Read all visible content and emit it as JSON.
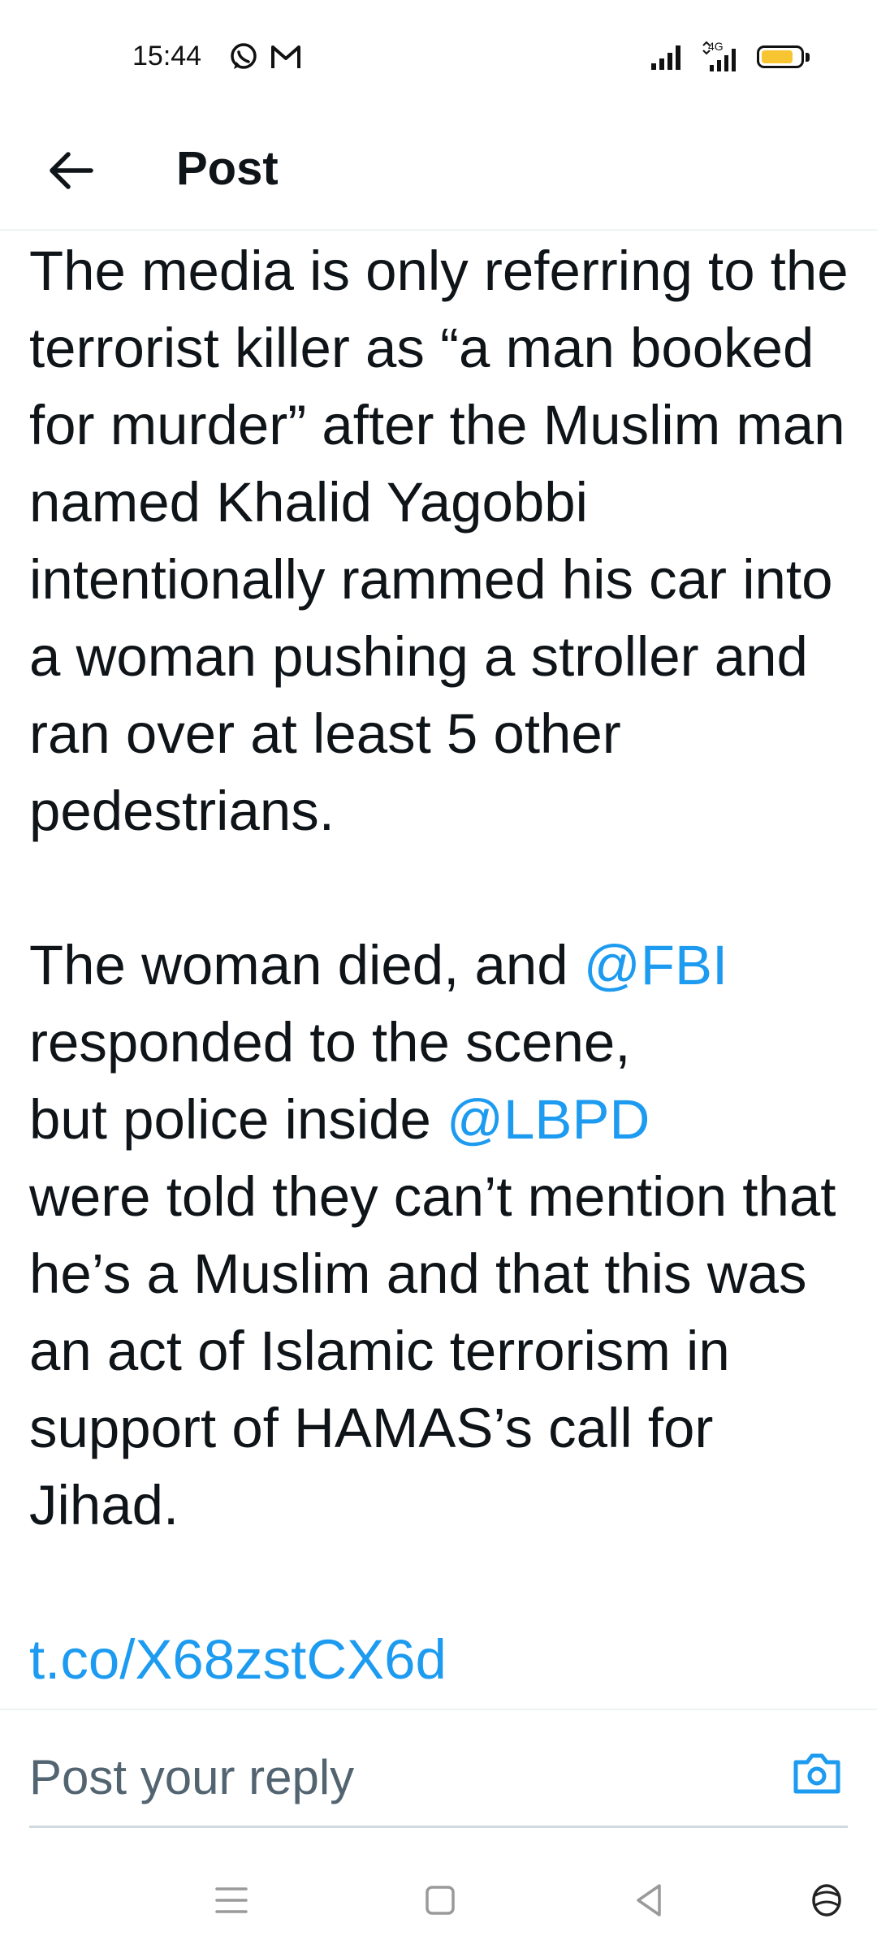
{
  "status_bar": {
    "time": "15:44",
    "network": "4G",
    "icons": [
      "whatsapp-icon",
      "gmail-icon",
      "signal-icon",
      "battery-icon"
    ],
    "battery_color": "#f7c531"
  },
  "header": {
    "title": "Post",
    "back_icon": "arrow-left-icon"
  },
  "post": {
    "paragraph1": "The media is only referring to the terrorist killer as “a man booked for murder” after the Muslim man named Khalid Yagobbi intentionally rammed his car into a woman pushing a stroller and ran over at least 5 other pedestrians.",
    "p2_part1": "The woman died, and ",
    "mention_fbi": "@FBI",
    "p2_part2": "responded to the scene,",
    "p2_part3": "but police inside ",
    "mention_lbpd": "@LBPD",
    "p2_part4": "were told they can’t mention that he’s a Muslim and that this was an act of Islamic terrorism in support of HAMAS’s call for Jihad.",
    "link": "t.co/X68zstCX6d",
    "link_color": "#1d9bf0"
  },
  "reply": {
    "placeholder": "Post your reply",
    "camera_icon": "camera-icon"
  },
  "nav_bar": {
    "icons": [
      "menu-icon",
      "home-square-icon",
      "back-triangle-icon",
      "assistant-icon"
    ]
  }
}
